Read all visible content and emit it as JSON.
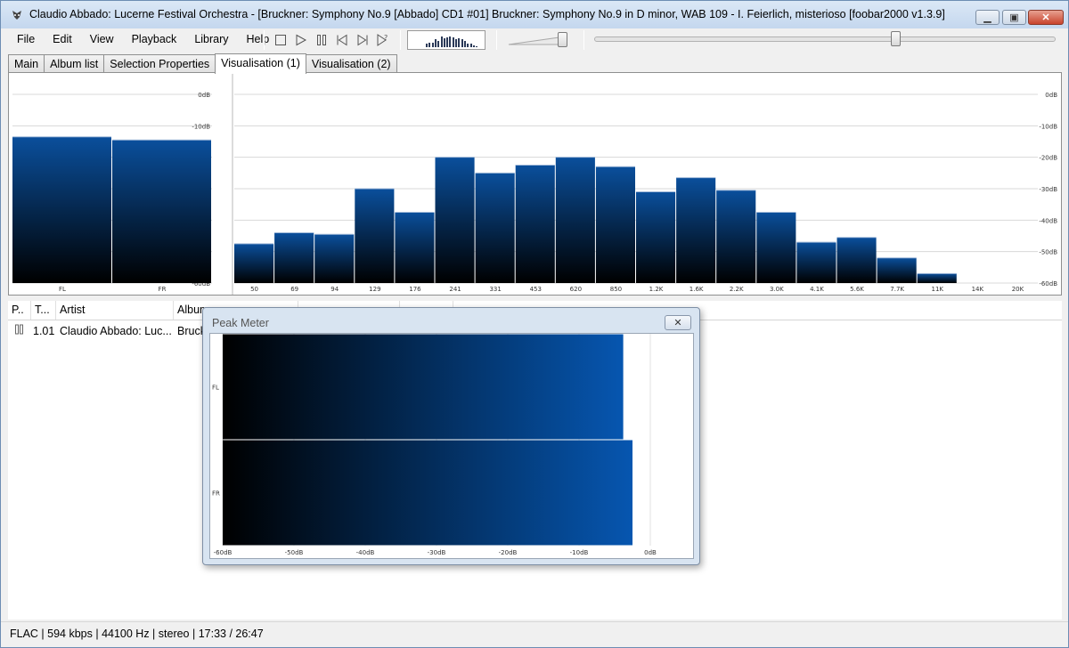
{
  "window": {
    "title": "Claudio Abbado: Lucerne Festival Orchestra - [Bruckner: Symphony No.9 [Abbado] CD1 #01] Bruckner: Symphony No.9 in D minor, WAB 109 - I. Feierlich, misterioso   [foobar2000 v1.3.9]",
    "minimize_icon": "minimize-icon",
    "maximize_icon": "maximize-icon",
    "close_icon": "close-icon"
  },
  "menu": [
    "File",
    "Edit",
    "View",
    "Playback",
    "Library",
    "Help"
  ],
  "toolbar": {
    "buttons": [
      "stop-icon",
      "play-icon",
      "pause-icon",
      "previous-icon",
      "next-icon",
      "random-icon"
    ],
    "volume_level": 0.85,
    "seek_fraction": 0.653
  },
  "tabs": [
    {
      "label": "Main",
      "active": false
    },
    {
      "label": "Album list",
      "active": false
    },
    {
      "label": "Selection Properties",
      "active": false
    },
    {
      "label": "Visualisation (1)",
      "active": true
    },
    {
      "label": "Visualisation (2)",
      "active": false
    }
  ],
  "colors": {
    "bar_top": "#0a4f9c",
    "bar_bottom": "#000000",
    "peak_right": "#0656b0",
    "peak_left": "#000000"
  },
  "chart_data": [
    {
      "type": "bar",
      "name": "channel-meter",
      "categories": [
        "FL",
        "FR"
      ],
      "values": [
        -13.5,
        -14.5
      ],
      "ylim": [
        -60,
        0
      ],
      "yticks": [
        "0dB",
        "-10dB",
        "-20dB",
        "-30dB",
        "-40dB",
        "-50dB",
        "-60dB"
      ],
      "grid": true
    },
    {
      "type": "bar",
      "name": "spectrum",
      "categories": [
        "50",
        "69",
        "94",
        "129",
        "176",
        "241",
        "331",
        "453",
        "620",
        "850",
        "1.2K",
        "1.6K",
        "2.2K",
        "3.0K",
        "4.1K",
        "5.6K",
        "7.7K",
        "11K",
        "14K",
        "20K"
      ],
      "values": [
        -47.5,
        -44,
        -44.5,
        -30,
        -37.5,
        -20,
        -25,
        -22.5,
        -20,
        -23,
        -31,
        -26.5,
        -30.5,
        -37.5,
        -47,
        -45.5,
        -52,
        -57,
        -60,
        -60
      ],
      "ylim": [
        -60,
        0
      ],
      "yticks": [
        "0dB",
        "-10dB",
        "-20dB",
        "-30dB",
        "-40dB",
        "-50dB",
        "-60dB"
      ],
      "grid": true
    },
    {
      "type": "bar",
      "name": "peak-meter",
      "orientation": "horizontal",
      "categories": [
        "FL",
        "FR"
      ],
      "values": [
        -3.8,
        -2.5
      ],
      "xlim": [
        -60,
        0
      ],
      "xticks": [
        "-60dB",
        "-50dB",
        "-40dB",
        "-30dB",
        "-20dB",
        "-10dB",
        "0dB"
      ]
    }
  ],
  "playlist": {
    "columns": [
      "P..",
      "T...",
      "Artist",
      "Album",
      "",
      "",
      ""
    ],
    "rows": [
      {
        "status_icon": "playing-icon",
        "track": "1.01",
        "artist": "Claudio Abbado: Luc...",
        "album": "Bruck"
      }
    ]
  },
  "peak_window": {
    "title": "Peak Meter",
    "close_icon": "close-icon"
  },
  "status": "FLAC | 594 kbps | 44100 Hz | stereo | 17:33 / 26:47"
}
